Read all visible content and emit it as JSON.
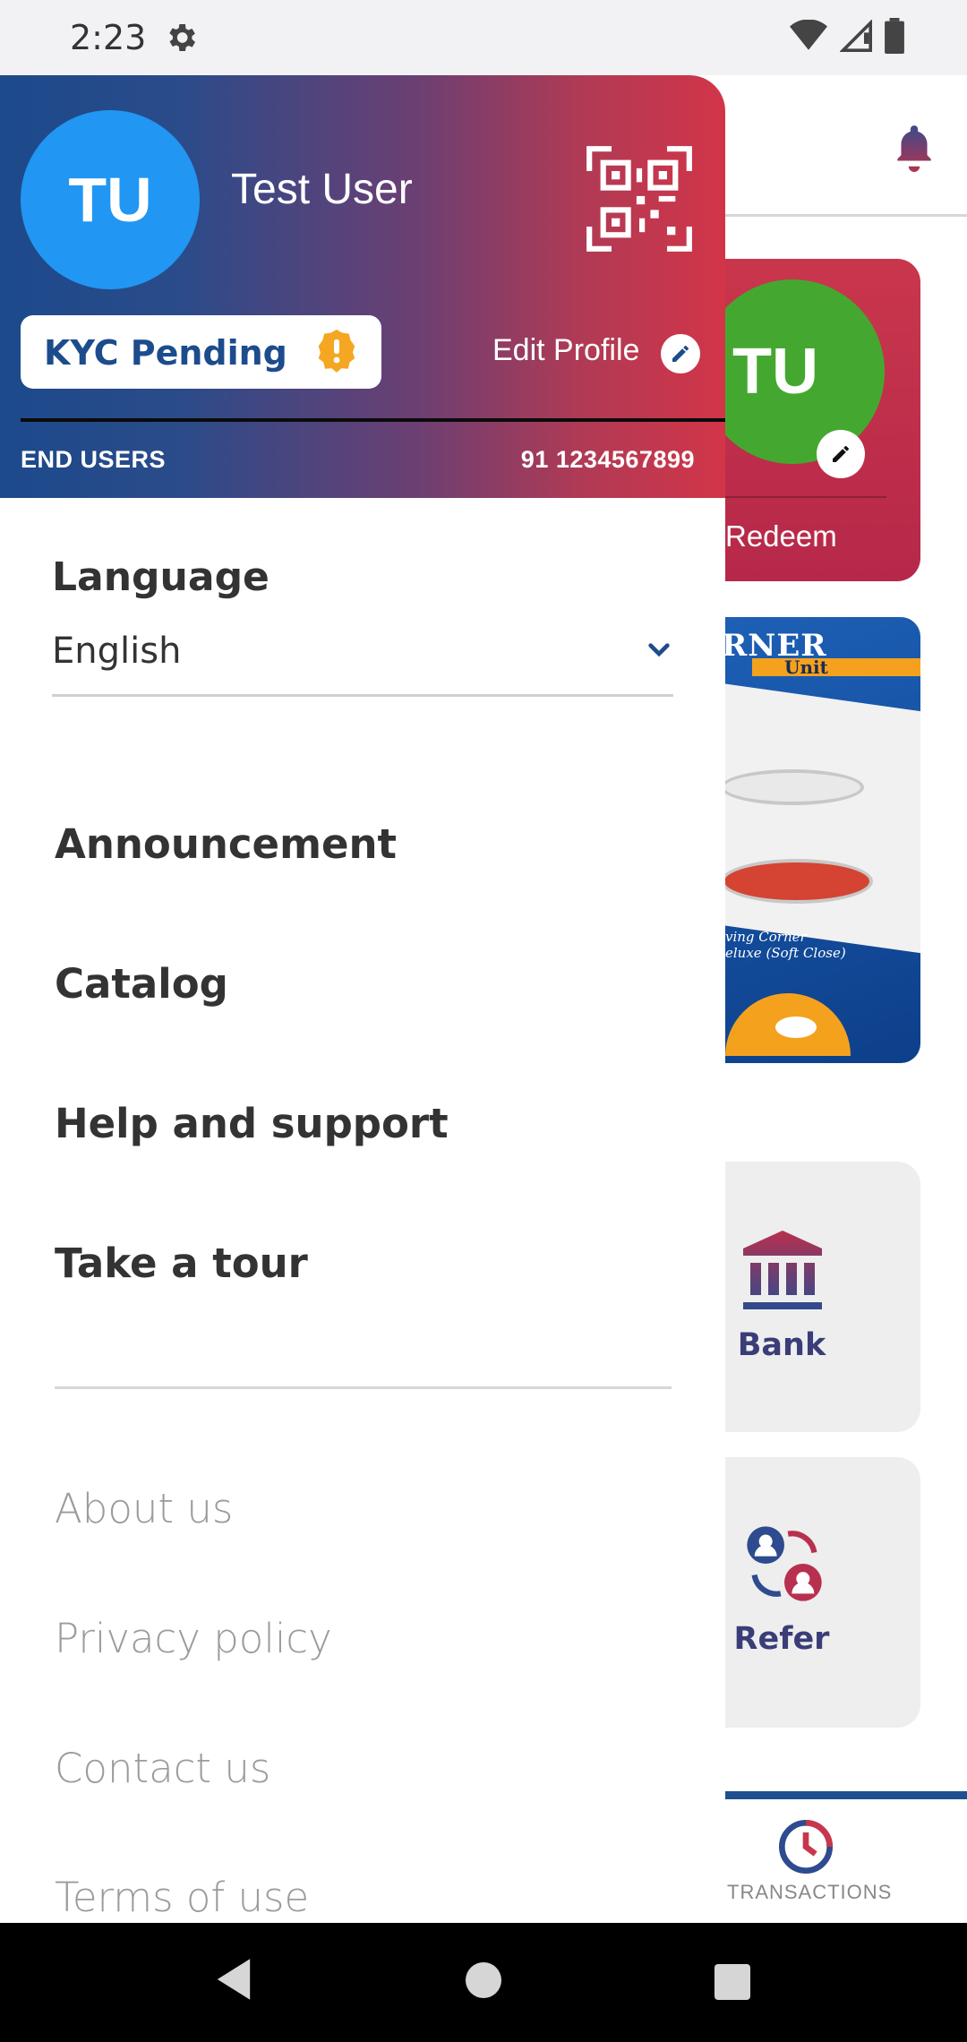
{
  "status_bar": {
    "time": "2:23"
  },
  "background": {
    "redeem_card": {
      "avatar_initials": "TU",
      "label": "Redeem"
    },
    "banner": {
      "title": "RNER",
      "subtitle": "Unit",
      "caption_line1": "ving Corner",
      "caption_line2": "eluxe (Soft Close)"
    },
    "tiles": [
      {
        "label": "Bank",
        "icon": "bank-icon"
      },
      {
        "label": "Refer",
        "icon": "refer-icon"
      }
    ],
    "bottom_nav": {
      "label": "TRANSACTIONS",
      "icon": "transactions-icon"
    }
  },
  "drawer": {
    "header": {
      "avatar_initials": "TU",
      "user_name": "Test User",
      "kyc_status": "KYC Pending",
      "edit_profile_label": "Edit Profile",
      "role": "END USERS",
      "phone": "91 1234567899"
    },
    "language": {
      "title": "Language",
      "selected": "English"
    },
    "menu": [
      "Announcement",
      "Catalog",
      "Help and support",
      "Take a tour"
    ],
    "links": [
      "About us",
      "Privacy policy",
      "Contact us",
      "Terms of use"
    ]
  },
  "colors": {
    "header_gradient_start": "#1c4a8b",
    "header_gradient_end": "#d23548",
    "avatar": "#2196f3",
    "kyc_text": "#1d4c8c",
    "warning": "#f5a623"
  }
}
